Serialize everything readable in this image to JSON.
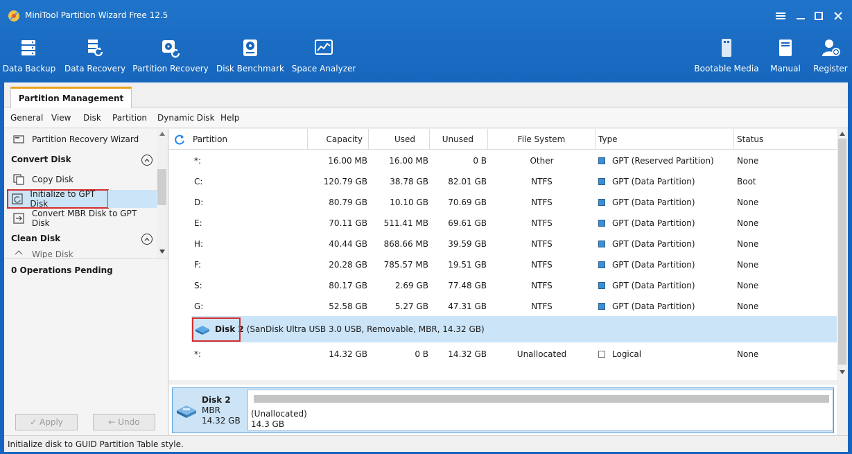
{
  "app": {
    "title": "MiniTool Partition Wizard Free 12.5"
  },
  "toolbar": {
    "left": [
      {
        "label": "Data Backup",
        "icon": "data-backup-icon"
      },
      {
        "label": "Data Recovery",
        "icon": "data-recovery-icon"
      },
      {
        "label": "Partition Recovery",
        "icon": "partition-recovery-icon"
      },
      {
        "label": "Disk Benchmark",
        "icon": "disk-benchmark-icon"
      },
      {
        "label": "Space Analyzer",
        "icon": "space-analyzer-icon"
      }
    ],
    "right": [
      {
        "label": "Bootable Media",
        "icon": "bootable-media-icon"
      },
      {
        "label": "Manual",
        "icon": "manual-icon"
      },
      {
        "label": "Register",
        "icon": "register-icon"
      }
    ]
  },
  "tabs": {
    "active": "Partition Management"
  },
  "menu": [
    "General",
    "View",
    "Disk",
    "Partition",
    "Dynamic Disk",
    "Help"
  ],
  "sidebar": {
    "wizard": "Partition Recovery Wizard",
    "sections": [
      {
        "title": "Convert Disk",
        "items": [
          "Copy Disk",
          "Initialize to GPT Disk",
          "Convert MBR Disk to GPT Disk"
        ]
      },
      {
        "title": "Clean Disk",
        "items": [
          "Wipe Disk"
        ]
      }
    ],
    "pending": "0 Operations Pending",
    "apply_label": "✓ Apply",
    "undo_label": "← Undo"
  },
  "table": {
    "headers": [
      "Partition",
      "Capacity",
      "Used",
      "Unused",
      "File System",
      "Type",
      "Status"
    ],
    "rows": [
      {
        "partition": "*:",
        "capacity": "16.00 MB",
        "used": "16.00 MB",
        "unused": "0 B",
        "fs": "Other",
        "type": "GPT (Reserved Partition)",
        "status": "None"
      },
      {
        "partition": "C:",
        "capacity": "120.79 GB",
        "used": "38.78 GB",
        "unused": "82.01 GB",
        "fs": "NTFS",
        "type": "GPT (Data Partition)",
        "status": "Boot"
      },
      {
        "partition": "D:",
        "capacity": "80.79 GB",
        "used": "10.10 GB",
        "unused": "70.69 GB",
        "fs": "NTFS",
        "type": "GPT (Data Partition)",
        "status": "None"
      },
      {
        "partition": "E:",
        "capacity": "70.11 GB",
        "used": "511.41 MB",
        "unused": "69.61 GB",
        "fs": "NTFS",
        "type": "GPT (Data Partition)",
        "status": "None"
      },
      {
        "partition": "H:",
        "capacity": "40.44 GB",
        "used": "868.66 MB",
        "unused": "39.59 GB",
        "fs": "NTFS",
        "type": "GPT (Data Partition)",
        "status": "None"
      },
      {
        "partition": "F:",
        "capacity": "20.28 GB",
        "used": "785.57 MB",
        "unused": "19.51 GB",
        "fs": "NTFS",
        "type": "GPT (Data Partition)",
        "status": "None"
      },
      {
        "partition": "S:",
        "capacity": "80.17 GB",
        "used": "2.69 GB",
        "unused": "77.48 GB",
        "fs": "NTFS",
        "type": "GPT (Data Partition)",
        "status": "None"
      },
      {
        "partition": "G:",
        "capacity": "52.58 GB",
        "used": "5.27 GB",
        "unused": "47.31 GB",
        "fs": "NTFS",
        "type": "GPT (Data Partition)",
        "status": "None"
      }
    ],
    "disk2": {
      "name": "Disk 2",
      "desc": "(SanDisk Ultra USB 3.0 USB, Removable, MBR, 14.32 GB)"
    },
    "disk2_row": {
      "partition": "*:",
      "capacity": "14.32 GB",
      "used": "0 B",
      "unused": "14.32 GB",
      "fs": "Unallocated",
      "type": "Logical",
      "status": "None"
    }
  },
  "diskmap": {
    "name": "Disk 2",
    "style": "MBR",
    "size": "14.32 GB",
    "unalloc_label": "(Unallocated)",
    "unalloc_size": "14.3 GB"
  },
  "statusbar": {
    "text": "Initialize disk to GUID Partition Table style."
  },
  "colors": {
    "header_blue": "#1766bd",
    "selection": "#cce4f7",
    "highlight_red": "#d32f2f",
    "tab_accent": "#e8a21c",
    "gpt_square": "#3a8fd6"
  }
}
